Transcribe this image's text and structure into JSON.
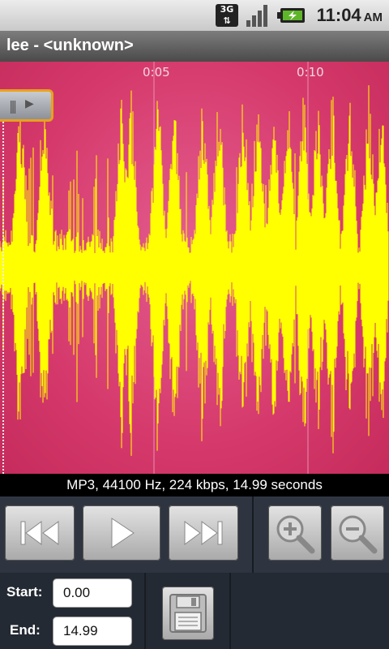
{
  "status": {
    "time": "11:04",
    "ampm": "AM",
    "network": "3G"
  },
  "title": "lee - <unknown>",
  "waveform": {
    "marks": [
      "0:05",
      "0:10"
    ],
    "colors": {
      "wave": "#ffff00",
      "background": "#d63a6c"
    }
  },
  "info": "MP3, 44100 Hz, 224 kbps, 14.99 seconds",
  "transport": {
    "icons": [
      "rewind-icon",
      "play-icon",
      "fast-forward-icon",
      "zoom-in-icon",
      "zoom-out-icon"
    ]
  },
  "range": {
    "start_label": "Start:",
    "start_value": "0.00",
    "end_label": "End:",
    "end_value": "14.99"
  },
  "save_icon": "floppy-disk-icon"
}
